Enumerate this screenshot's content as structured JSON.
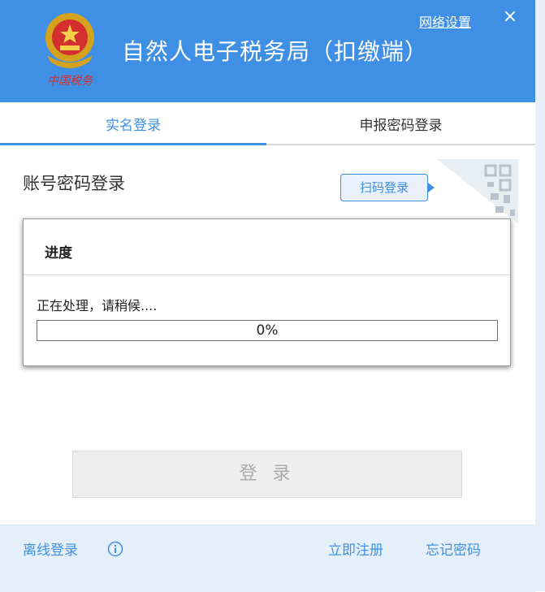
{
  "header": {
    "title": "自然人电子税务局（扣缴端）",
    "network_settings": "网络设置",
    "close_glyph": "×",
    "logo_text": "中国税务",
    "accent_color": "#3f8fe4"
  },
  "tabs": [
    {
      "label": "实名登录",
      "active": true
    },
    {
      "label": "申报密码登录",
      "active": false
    }
  ],
  "login": {
    "section_title": "账号密码登录",
    "scan_button": "扫码登录",
    "login_button": "登 录"
  },
  "dialog": {
    "title": "进度",
    "message": "正在处理，请稍候....",
    "progress_percent": 0,
    "progress_text": "0%"
  },
  "footer": {
    "offline_login": "离线登录",
    "register": "立即注册",
    "forgot_password": "忘记密码"
  }
}
